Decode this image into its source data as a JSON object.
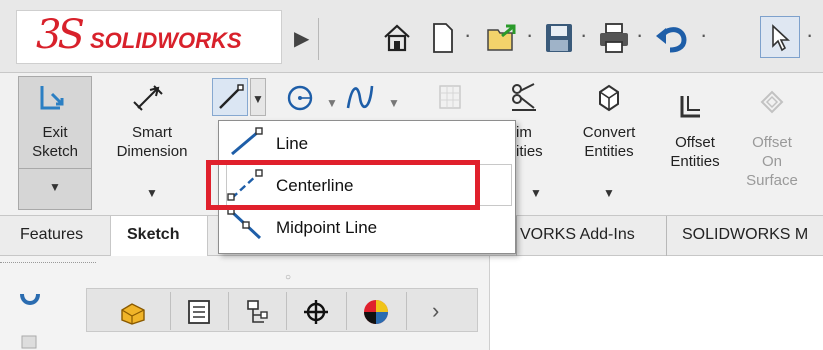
{
  "brand": {
    "logo_mark": "3S",
    "logo_text": "SOLIDWORKS"
  },
  "quick_access": {
    "icons": [
      "home-icon",
      "new-document-icon",
      "open-icon",
      "save-icon",
      "print-icon",
      "undo-icon",
      "select-icon"
    ]
  },
  "ribbon": {
    "exit_sketch": {
      "line1": "Exit",
      "line2": "Sketch"
    },
    "smart_dimension": {
      "line1": "Smart",
      "line2": "Dimension"
    },
    "trim_entities": {
      "line1": "im",
      "line2": "ities"
    },
    "convert_entities": {
      "line1": "Convert",
      "line2": "Entities"
    },
    "offset_entities": {
      "line1": "Offset",
      "line2": "Entities"
    },
    "offset_on_surface": {
      "line1": "Offset",
      "line2": "On",
      "line3": "Surface"
    }
  },
  "line_menu": {
    "items": [
      {
        "label": "Line"
      },
      {
        "label": "Centerline"
      },
      {
        "label": "Midpoint Line"
      }
    ]
  },
  "tabs": [
    {
      "label": "Features"
    },
    {
      "label": "Sketch"
    },
    {
      "label": "VORKS Add-Ins"
    },
    {
      "label": "SOLIDWORKS M"
    }
  ],
  "colors": {
    "accent_red": "#e0202c",
    "brand_red": "#d8212b",
    "icon_blue": "#1e5ea8"
  }
}
